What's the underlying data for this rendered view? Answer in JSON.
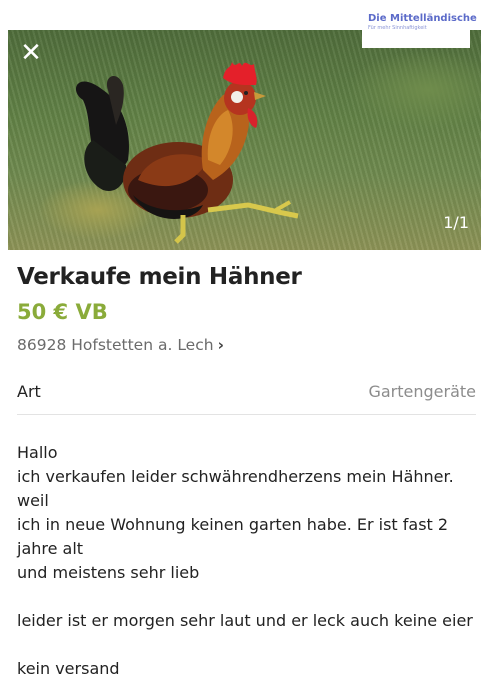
{
  "header": {
    "close_icon": "close-icon",
    "image_counter": "1/1"
  },
  "watermark": {
    "title": "Die Mittelländische",
    "subtitle": "Für mehr Sinnhaftigkeit"
  },
  "listing": {
    "title": "Verkaufe mein Hähner",
    "price": "50 € VB",
    "price_color": "#8aab3a",
    "location": "86928 Hofstetten a. Lech",
    "location_icon": "chevron-right-icon"
  },
  "attributes": [
    {
      "label": "Art",
      "value": "Gartengeräte"
    }
  ],
  "description": {
    "lines": [
      "Hallo",
      "ich verkaufen leider schwährendherzens mein Hähner. weil",
      "ich in neue Wohnung keinen garten habe. Er ist fast 2 jahre alt",
      "und meistens sehr lieb",
      "leider ist er morgen sehr laut und er leck auch keine eier",
      "kein versand"
    ]
  }
}
